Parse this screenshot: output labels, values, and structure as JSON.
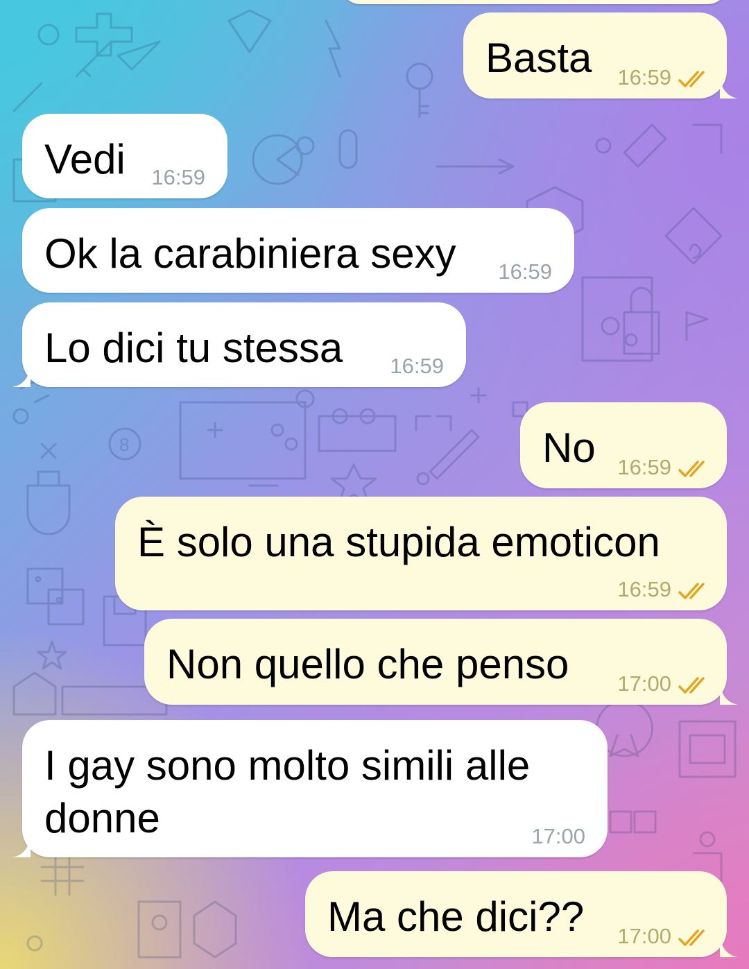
{
  "chat": {
    "messages": [
      {
        "id": "m1",
        "direction": "outgoing",
        "text": "Basta",
        "time": "16:59",
        "status_icon": "double-check-icon"
      },
      {
        "id": "m2",
        "direction": "incoming",
        "text": "Vedi",
        "time": "16:59"
      },
      {
        "id": "m3",
        "direction": "incoming",
        "text": "Ok la carabiniera sexy",
        "time": "16:59"
      },
      {
        "id": "m4",
        "direction": "incoming",
        "text": "Lo dici tu stessa",
        "time": "16:59"
      },
      {
        "id": "m5",
        "direction": "outgoing",
        "text": "No",
        "time": "16:59",
        "status_icon": "double-check-icon"
      },
      {
        "id": "m6",
        "direction": "outgoing",
        "text": "È solo una stupida emoticon",
        "time": "16:59",
        "status_icon": "double-check-icon"
      },
      {
        "id": "m7",
        "direction": "outgoing",
        "text": "Non quello che penso",
        "time": "17:00",
        "status_icon": "double-check-icon"
      },
      {
        "id": "m8",
        "direction": "incoming",
        "text_line1": "I gay sono molto simili alle",
        "text_line2": "donne",
        "time": "17:00"
      },
      {
        "id": "m9",
        "direction": "outgoing",
        "text": "Ma che dici??",
        "time": "17:00",
        "status_icon": "double-check-icon"
      }
    ]
  },
  "colors": {
    "incoming_bubble": "#ffffff",
    "outgoing_bubble": "#fefbdc",
    "check_color": "#e3a51e",
    "time_incoming": "#9aa3aa",
    "time_outgoing": "#b4a96c"
  }
}
